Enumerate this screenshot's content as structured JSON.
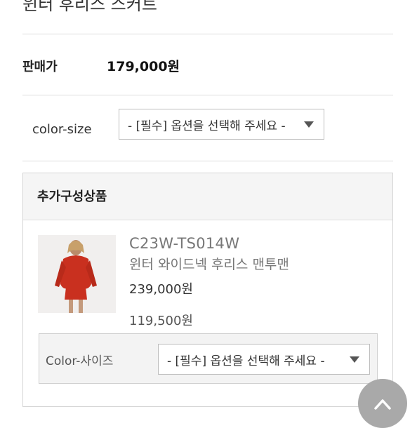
{
  "product_title": "윈터 후리스 스커트",
  "price": {
    "label": "판매가",
    "value": "179,000원"
  },
  "option": {
    "label": "color-size",
    "select_value": "- [필수] 옵션을 선택해 주세요 -"
  },
  "additional": {
    "heading": "추가구성상품",
    "item": {
      "code": "C23W-TS014W",
      "name": "윈터 와이드넥 후리스 맨투맨",
      "original_price": "239,000원",
      "sale_price": "119,500원",
      "option_label": "Color-사이즈",
      "option_select_value": "- [필수] 옵션을 선택해 주세요 -"
    }
  },
  "colors": {
    "divider": "#dcdcdc",
    "panel": "#f5f5f5",
    "fab": "#a9a9a9",
    "product_red": "#c9301f"
  },
  "icons": {
    "dropdown": "caret-down-icon",
    "scroll_top": "chevron-up-icon"
  }
}
